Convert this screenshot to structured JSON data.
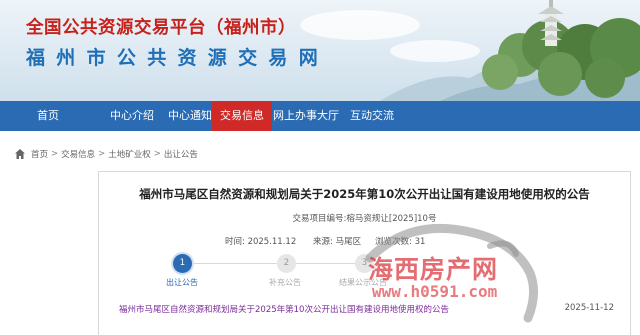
{
  "header": {
    "title_line1": "全国公共资源交易平台（福州市）",
    "title_line2": "福州市公共资源交易网"
  },
  "nav": {
    "items": [
      {
        "label": "首页"
      },
      {
        "label": "中心介绍"
      },
      {
        "label": "中心通知"
      },
      {
        "label": "交易信息"
      },
      {
        "label": "网上办事大厅"
      },
      {
        "label": "互动交流"
      }
    ],
    "active": "交易信息"
  },
  "breadcrumb": {
    "items": [
      "首页",
      "交易信息",
      "土地矿业权",
      "出让公告"
    ],
    "separator": ">"
  },
  "notice": {
    "title": "福州市马尾区自然资源和规划局关于2025年第10次公开出让国有建设用地使用权的公告",
    "project_no": "交易项目编号:榕马资规让[2025]10号",
    "time": "时间: 2025.11.12",
    "source": "来源: 马尾区",
    "views": "浏览次数: 31"
  },
  "steps": [
    {
      "num": "1",
      "label": "出让公告",
      "state": "active"
    },
    {
      "num": "2",
      "label": "补充公告",
      "state": "inactive"
    },
    {
      "num": "3",
      "label": "结果公示公告",
      "state": "inactive"
    }
  ],
  "list": [
    {
      "title": "福州市马尾区自然资源和规划局关于2025年第10次公开出让国有建设用地使用权的公告",
      "date": "2025-11-12"
    }
  ],
  "watermark": {
    "line1": "海西房产网",
    "line2": "www.h0591.com"
  },
  "colors": {
    "nav_bg": "#2a6bb3",
    "nav_active": "#cf2a27",
    "title_red": "#c8211b",
    "title_blue": "#1f6fb8",
    "link_purple": "#7a2a9a"
  }
}
